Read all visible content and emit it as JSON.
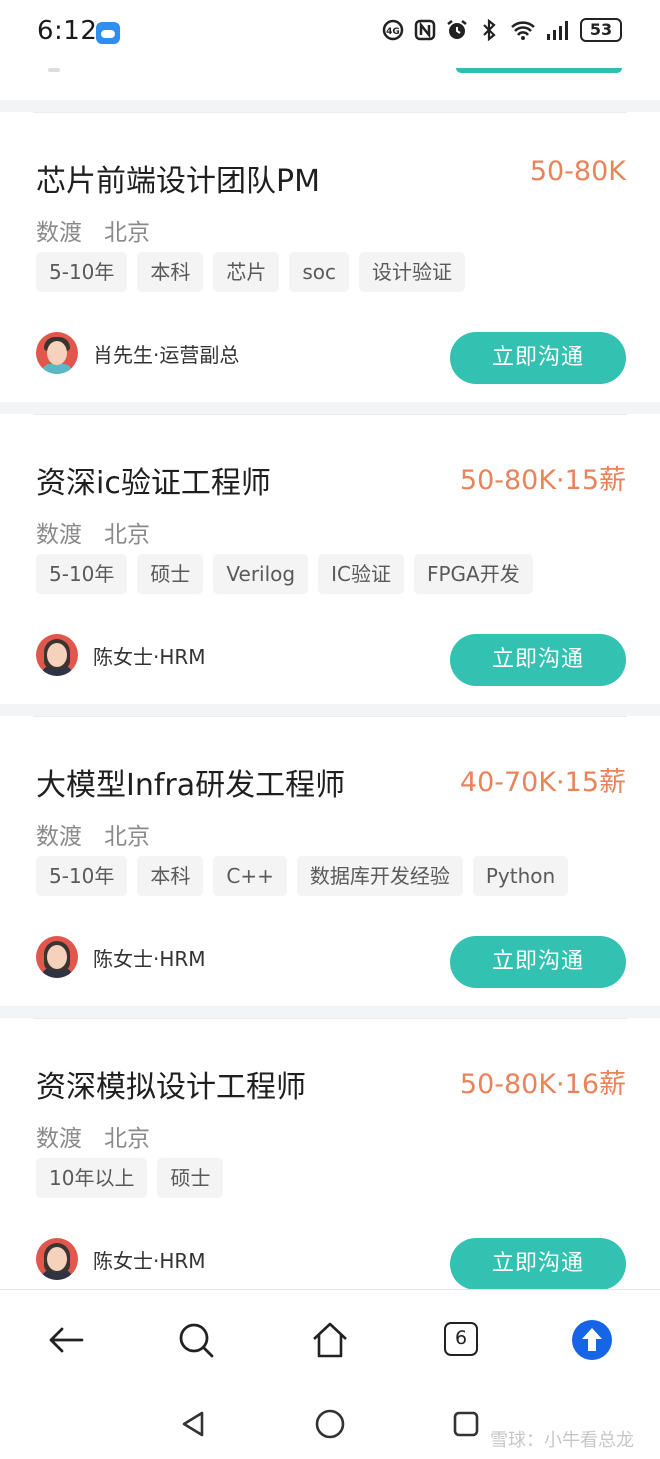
{
  "status_bar": {
    "time": "6:12",
    "battery": "53",
    "icons": [
      "weather-icon",
      "data-saver-icon",
      "nfc-icon",
      "alarm-icon",
      "bluetooth-icon",
      "wifi-icon",
      "signal-icon",
      "battery-icon"
    ]
  },
  "colors": {
    "accent": "#33c1b1",
    "salary": "#e9845a",
    "tag_bg": "#f4f4f5",
    "up_button": "#1565e6"
  },
  "jobs": [
    {
      "title": "芯片前端设计团队PM",
      "salary": "50-80K",
      "company": "数渡",
      "city": "北京",
      "tags": [
        "5-10年",
        "本科",
        "芯片",
        "soc",
        "设计验证"
      ],
      "recruiter": "肖先生·运营副总",
      "button": "立即沟通"
    },
    {
      "title": "资深ic验证工程师",
      "salary": "50-80K·15薪",
      "company": "数渡",
      "city": "北京",
      "tags": [
        "5-10年",
        "硕士",
        "Verilog",
        "IC验证",
        "FPGA开发"
      ],
      "recruiter": "陈女士·HRM",
      "button": "立即沟通"
    },
    {
      "title": "大模型Infra研发工程师",
      "salary": "40-70K·15薪",
      "company": "数渡",
      "city": "北京",
      "tags": [
        "5-10年",
        "本科",
        "C++",
        "数据库开发经验",
        "Python"
      ],
      "recruiter": "陈女士·HRM",
      "button": "立即沟通"
    },
    {
      "title": "资深模拟设计工程师",
      "salary": "50-80K·16薪",
      "company": "数渡",
      "city": "北京",
      "tags": [
        "10年以上",
        "硕士"
      ],
      "recruiter": "陈女士·HRM",
      "button": "立即沟通"
    }
  ],
  "browser_bar": {
    "tab_count": "6",
    "icons": [
      "back-arrow-icon",
      "search-icon",
      "home-icon",
      "tabs-icon",
      "scroll-up-icon"
    ]
  },
  "system_nav": {
    "icons": [
      "nav-back-icon",
      "nav-home-icon",
      "nav-recents-icon"
    ]
  },
  "watermark": "雪球：小牛看总龙"
}
